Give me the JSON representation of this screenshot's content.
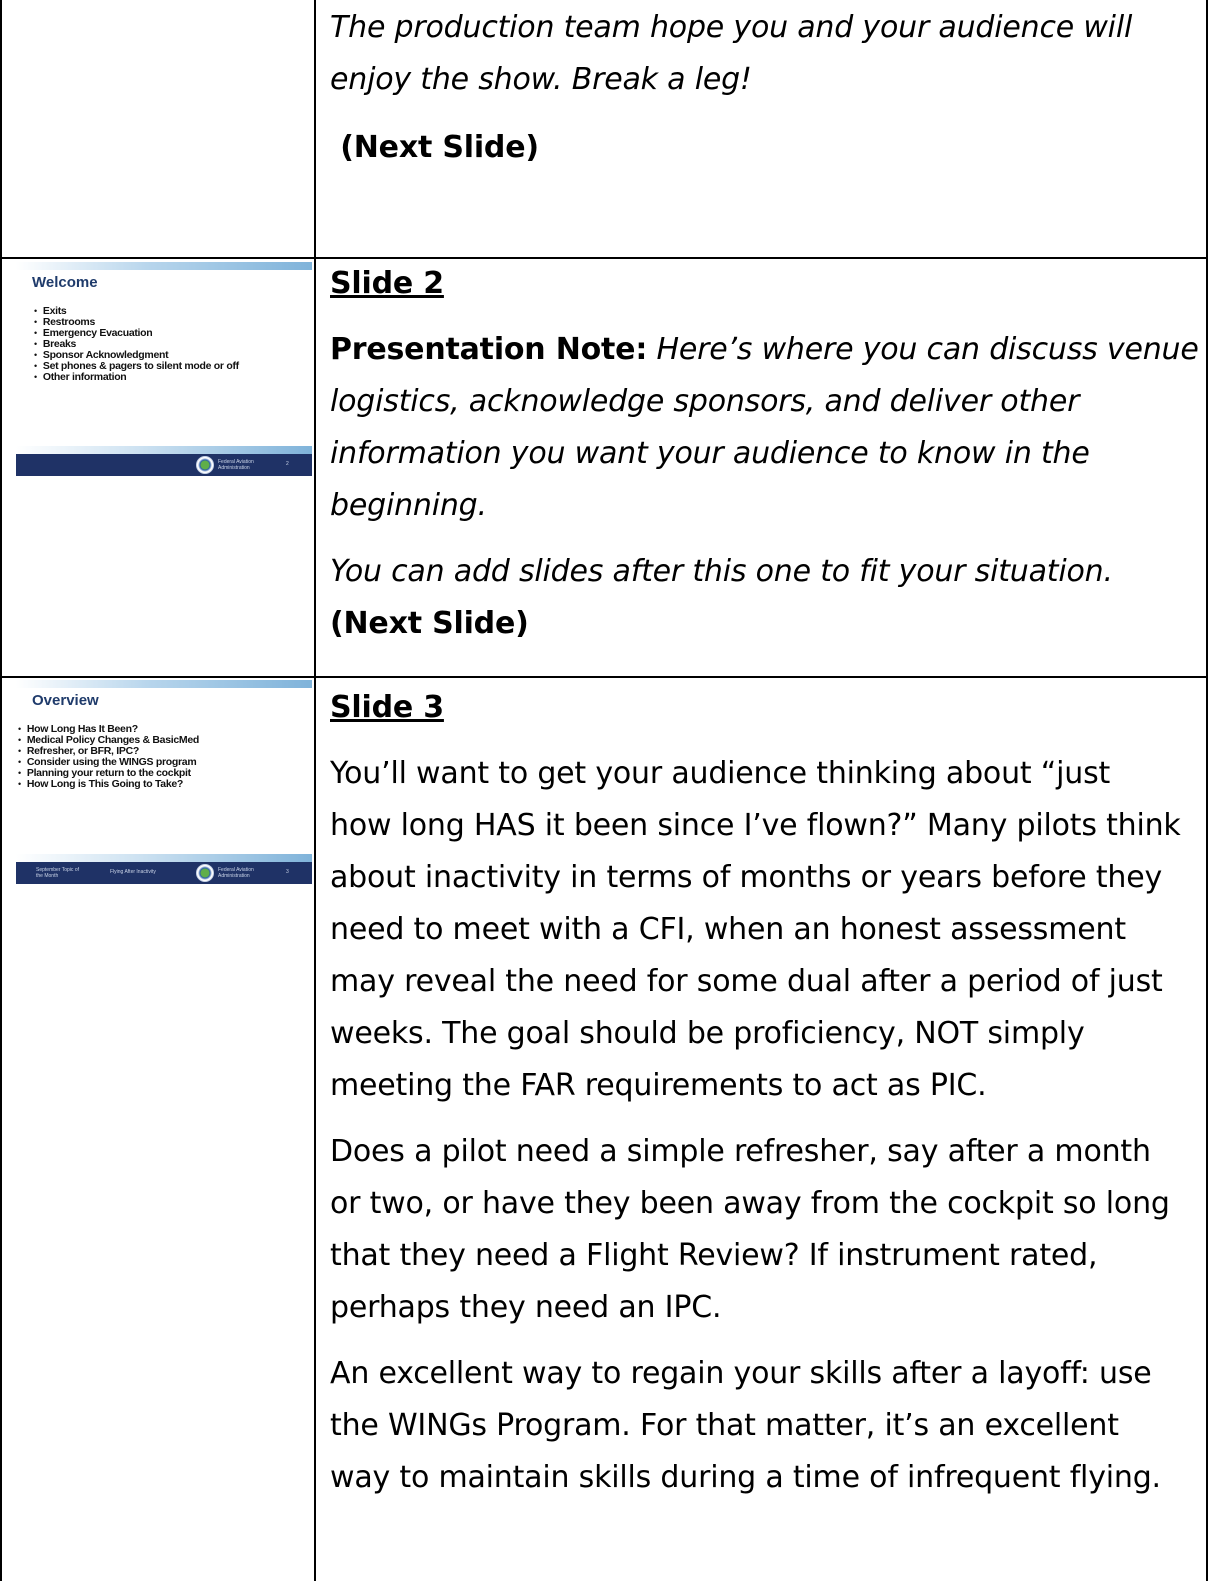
{
  "row1": {
    "line1": "The production team hope you and your audience will",
    "line2": "enjoy the show.   Break a leg!",
    "next": "(Next Slide)"
  },
  "row2": {
    "thumb": {
      "title": "Welcome",
      "bullets": [
        "Exits",
        "Restrooms",
        "Emergency Evacuation",
        "Breaks",
        "Sponsor Acknowledgment",
        "Set phones & pagers to silent mode or off",
        "Other information"
      ],
      "footer_org": "Federal Aviation\nAdministration",
      "page": "2"
    },
    "heading": "Slide 2",
    "note_label": "Presentation Note:",
    "note_l1": " Here’s where you can discuss venue",
    "note_l2": "logistics, acknowledge sponsors, and deliver other",
    "note_l3": "information you want your audience to know in the",
    "note_l4": "beginning.",
    "add_slides": "You can add slides after this one to fit your situation.",
    "next": "(Next Slide)"
  },
  "row3": {
    "thumb": {
      "title": "Overview",
      "bullets": [
        "How Long Has It Been?",
        "Medical Policy Changes & BasicMed",
        "Refresher, or BFR, IPC?",
        "Consider using the WINGS program",
        "Planning your return to the cockpit",
        "How Long is This Going to Take?"
      ],
      "footer_left": "September Topic of\nthe Month",
      "footer_mid": "Flying After Inactivity",
      "footer_org": "Federal Aviation\nAdministration",
      "page": "3"
    },
    "heading": "Slide 3",
    "para1": [
      "You’ll want to get your audience thinking about “just",
      "how long HAS it been since I’ve flown?” Many pilots think",
      "about inactivity in terms of months or years before they",
      "need to meet with a CFI, when an honest assessment",
      "may reveal the need for some dual after a period of just",
      "weeks.  The goal should be proficiency, NOT simply",
      "meeting the FAR requirements to act as PIC."
    ],
    "para2": [
      "Does a pilot need a simple refresher, say after a month",
      "or two, or have they been away from the cockpit so long",
      "that they need a Flight Review?  If instrument rated,",
      "perhaps they need an IPC."
    ],
    "para3": [
      "An excellent way to regain your skills after a layoff: use",
      "the WINGs Program.  For that matter, it’s an excellent",
      "way to maintain skills during a time of infrequent flying."
    ]
  }
}
